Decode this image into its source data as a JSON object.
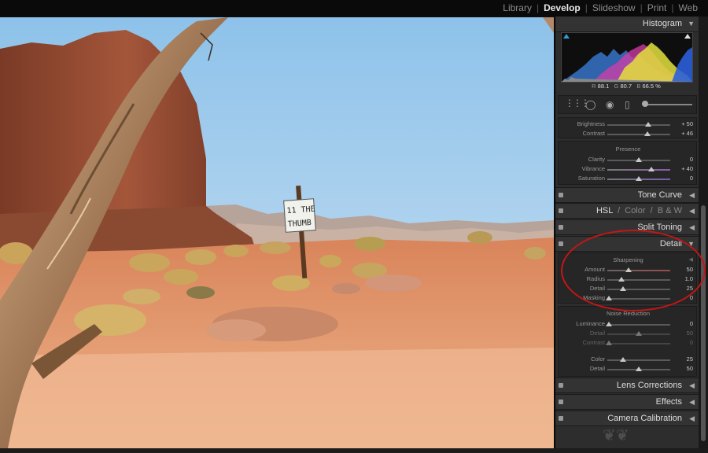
{
  "modules": [
    "Library",
    "Develop",
    "Slideshow",
    "Print",
    "Web"
  ],
  "active_module": "Develop",
  "photo": {
    "sign_line1": "11 THE",
    "sign_line2": "THUMB"
  },
  "histogram": {
    "title": "Histogram",
    "r_label": "R",
    "r_value": "88.1",
    "g_label": "G",
    "g_value": "80.7",
    "b_label": "B",
    "b_value": "66.5",
    "unit": "%"
  },
  "basic": {
    "brightness": {
      "label": "Brightness",
      "value": "+ 50",
      "pos": 0.65
    },
    "contrast": {
      "label": "Contrast",
      "value": "+ 46",
      "pos": 0.64
    },
    "presence_label": "Presence",
    "clarity": {
      "label": "Clarity",
      "value": "0",
      "pos": 0.5
    },
    "vibrance": {
      "label": "Vibrance",
      "value": "+ 40",
      "pos": 0.7
    },
    "saturation": {
      "label": "Saturation",
      "value": "0",
      "pos": 0.5
    }
  },
  "sections": {
    "tone_curve": "Tone Curve",
    "hsl": "HSL",
    "color": "Color",
    "bw": "B & W",
    "split_toning": "Split Toning",
    "detail": "Detail",
    "lens_corrections": "Lens Corrections",
    "effects": "Effects",
    "camera_calibration": "Camera Calibration"
  },
  "detail": {
    "sharpening_label": "Sharpening",
    "amount": {
      "label": "Amount",
      "value": "50",
      "pos": 0.34
    },
    "radius": {
      "label": "Radius",
      "value": "1.0",
      "pos": 0.22
    },
    "detail": {
      "label": "Detail",
      "value": "25",
      "pos": 0.25
    },
    "masking": {
      "label": "Masking",
      "value": "0",
      "pos": 0.02
    },
    "noise_label": "Noise Reduction",
    "luminance": {
      "label": "Luminance",
      "value": "0",
      "pos": 0.02
    },
    "lum_detail": {
      "label": "Detail",
      "value": "50",
      "pos": 0.5
    },
    "lum_contrast": {
      "label": "Contrast",
      "value": "0",
      "pos": 0.02
    },
    "color": {
      "label": "Color",
      "value": "25",
      "pos": 0.25
    },
    "color_detail": {
      "label": "Detail",
      "value": "50",
      "pos": 0.5
    }
  },
  "colors": {
    "annotation": "#c41616",
    "panel_bg": "#2d2d2d",
    "sky": "#a5cdeb"
  },
  "icons": [
    "crop-overlay-icon",
    "spot-removal-icon",
    "red-eye-icon",
    "graduated-filter-icon",
    "adjustment-brush-icon",
    "panel-ornament-icon"
  ]
}
